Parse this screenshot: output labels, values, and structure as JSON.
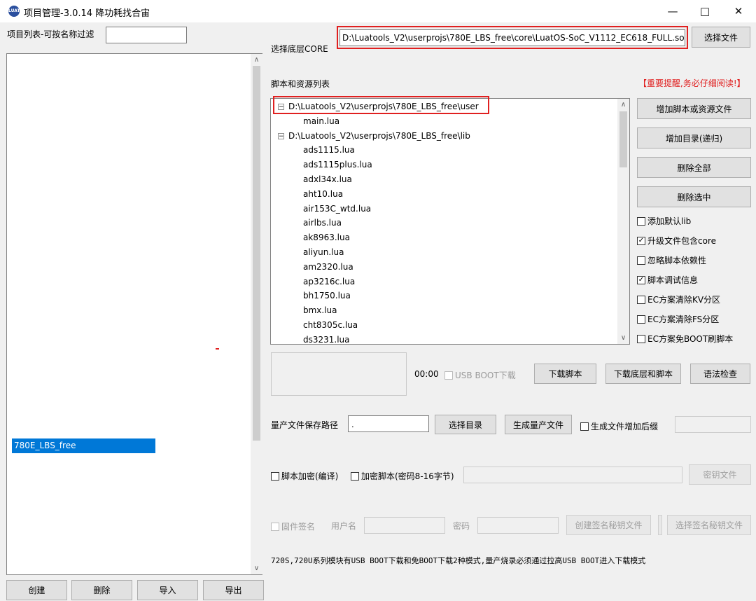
{
  "window": {
    "title": "项目管理-3.0.14 降功耗找合宙",
    "logo_text": "LUAT"
  },
  "left": {
    "filter_label": "项目列表-可按名称过滤",
    "filter_value": "",
    "selected_project": "780E_LBS_free",
    "buttons": [
      "创建",
      "删除",
      "导入",
      "导出"
    ]
  },
  "core": {
    "label": "选择底层CORE",
    "path": "D:\\Luatools_V2\\userprojs\\780E_LBS_free\\core\\LuatOS-SoC_V1112_EC618_FULL.soc",
    "select_button": "选择文件"
  },
  "scripts": {
    "label": "脚本和资源列表",
    "warning": "【重要提醒,务必仔细阅读!】",
    "tree": [
      {
        "text": "D:\\Luatools_V2\\userprojs\\780E_LBS_free\\user",
        "level": 0
      },
      {
        "text": "main.lua",
        "level": 1
      },
      {
        "text": "D:\\Luatools_V2\\userprojs\\780E_LBS_free\\lib",
        "level": 0
      },
      {
        "text": "ads1115.lua",
        "level": 1
      },
      {
        "text": "ads1115plus.lua",
        "level": 1
      },
      {
        "text": "adxl34x.lua",
        "level": 1
      },
      {
        "text": "aht10.lua",
        "level": 1
      },
      {
        "text": "air153C_wtd.lua",
        "level": 1
      },
      {
        "text": "airlbs.lua",
        "level": 1
      },
      {
        "text": "ak8963.lua",
        "level": 1
      },
      {
        "text": "aliyun.lua",
        "level": 1
      },
      {
        "text": "am2320.lua",
        "level": 1
      },
      {
        "text": "ap3216c.lua",
        "level": 1
      },
      {
        "text": "bh1750.lua",
        "level": 1
      },
      {
        "text": "bmx.lua",
        "level": 1
      },
      {
        "text": "cht8305c.lua",
        "level": 1
      },
      {
        "text": "ds3231.lua",
        "level": 1
      }
    ],
    "side_buttons": [
      "增加脚本或资源文件",
      "增加目录(递归)",
      "删除全部",
      "删除选中"
    ],
    "options": [
      {
        "label": "添加默认lib",
        "checked": false
      },
      {
        "label": "升级文件包含core",
        "checked": true
      },
      {
        "label": "忽略脚本依赖性",
        "checked": false
      },
      {
        "label": "脚本调试信息",
        "checked": true
      },
      {
        "label": "EC方案清除KV分区",
        "checked": false
      },
      {
        "label": "EC方案清除FS分区",
        "checked": false
      },
      {
        "label": "EC方案免BOOT刷脚本",
        "checked": false
      }
    ]
  },
  "download": {
    "time": "00:00",
    "usb_boot_label": "USB BOOT下载",
    "buttons": [
      "下载脚本",
      "下载底层和脚本",
      "语法检查"
    ]
  },
  "production": {
    "path_label": "量产文件保存路径",
    "path_value": ".",
    "select_dir": "选择目录",
    "generate": "生成量产文件",
    "suffix_label": "生成文件增加后缀",
    "suffix_value": ""
  },
  "encrypt": {
    "compile_label": "脚本加密(编译)",
    "password_label": "加密脚本(密码8-16字节)",
    "password_value": "",
    "key_file": "密钥文件"
  },
  "sign": {
    "label": "固件签名",
    "user_label": "用户名",
    "pwd_label": "密码",
    "create": "创建签名秘钥文件",
    "select": "选择签名秘钥文件"
  },
  "footer_note": "720S,720U系列模块有USB BOOT下载和免BOOT下载2种模式,量产烧录必须通过拉高USB BOOT进入下载模式"
}
